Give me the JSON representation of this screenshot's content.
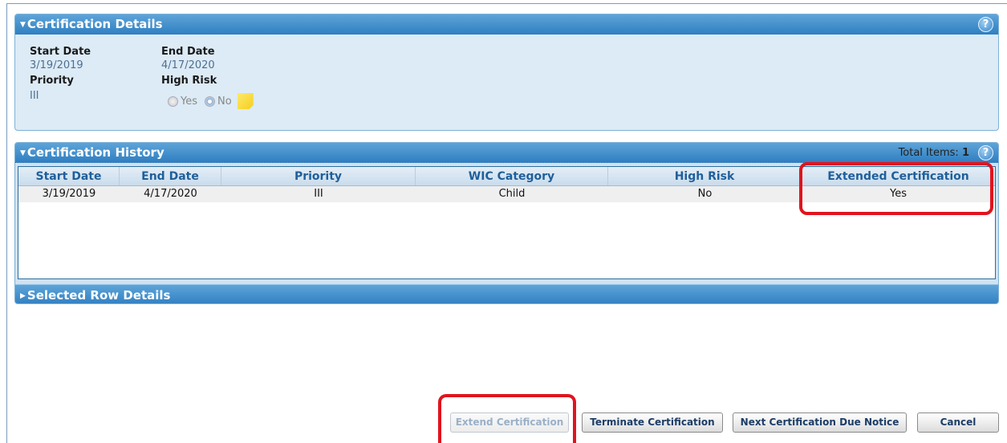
{
  "details": {
    "title": "Certification Details",
    "start_date_label": "Start Date",
    "start_date": "3/19/2019",
    "end_date_label": "End Date",
    "end_date": "4/17/2020",
    "priority_label": "Priority",
    "priority": "III",
    "high_risk_label": "High Risk",
    "high_risk_yes": "Yes",
    "high_risk_no": "No",
    "high_risk_selected": "No",
    "help_icon": "?"
  },
  "history": {
    "title": "Certification History",
    "total_items_label": "Total Items:",
    "total_items": "1",
    "help_icon": "?",
    "columns": [
      "Start Date",
      "End Date",
      "Priority",
      "WIC Category",
      "High Risk",
      "Extended Certification"
    ],
    "rows": [
      [
        "3/19/2019",
        "4/17/2020",
        "III",
        "Child",
        "No",
        "Yes"
      ]
    ],
    "selected_row_details": "Selected Row Details"
  },
  "buttons": {
    "extend": "Extend Certification",
    "terminate": "Terminate Certification",
    "next_notice": "Next Certification Due Notice",
    "cancel": "Cancel"
  },
  "colors": {
    "header_blue": "#2f7fc2",
    "highlight_red": "#e0141e",
    "panel_bg": "#dcebf6"
  }
}
